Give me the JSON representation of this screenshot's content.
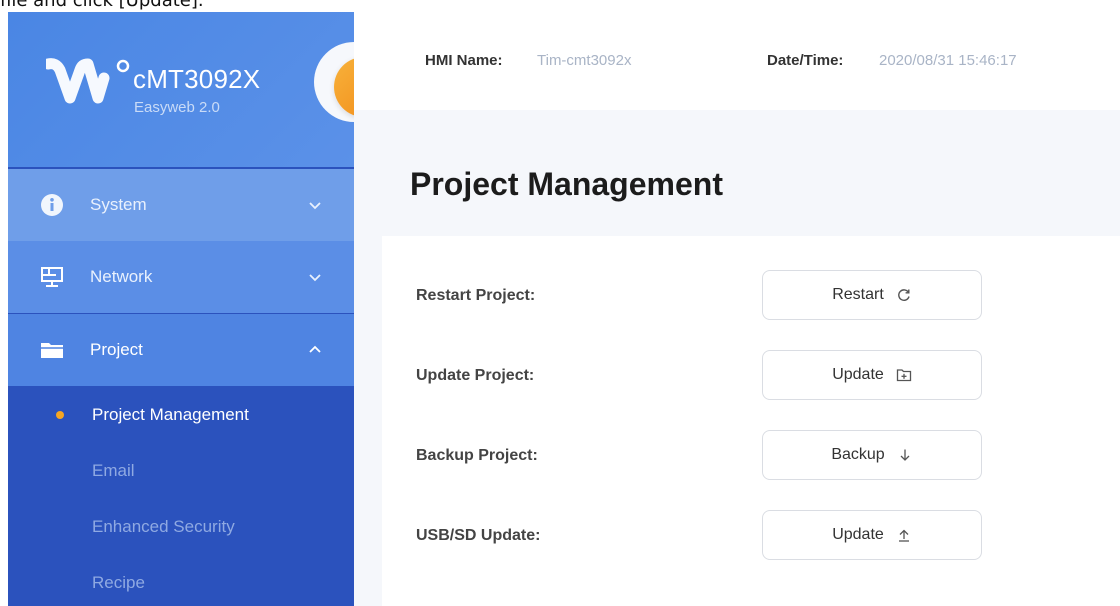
{
  "caption": "file and click [Update].",
  "brand": {
    "name": "cMT3092X",
    "subtitle": "Easyweb 2.0"
  },
  "sidebar": {
    "items": [
      {
        "label": "System",
        "icon": "info-icon",
        "expanded": false
      },
      {
        "label": "Network",
        "icon": "network-icon",
        "expanded": false
      },
      {
        "label": "Project",
        "icon": "folder-icon",
        "expanded": true
      }
    ],
    "sub_items": [
      {
        "label": "Project Management",
        "active": true
      },
      {
        "label": "Email",
        "active": false
      },
      {
        "label": "Enhanced Security",
        "active": false
      },
      {
        "label": "Recipe",
        "active": false
      }
    ]
  },
  "header": {
    "hmi_name_label": "HMI Name:",
    "hmi_name_value": "Tim-cmt3092x",
    "datetime_label": "Date/Time:",
    "datetime_value": "2020/08/31 15:46:17"
  },
  "main": {
    "title": "Project Management",
    "rows": [
      {
        "label": "Restart Project:",
        "button": "Restart",
        "icon": "refresh-icon"
      },
      {
        "label": "Update Project:",
        "button": "Update",
        "icon": "folder-plus-icon"
      },
      {
        "label": "Backup Project:",
        "button": "Backup",
        "icon": "download-arrow-icon"
      },
      {
        "label": "USB/SD Update:",
        "button": "Update",
        "icon": "upload-arrow-icon"
      }
    ]
  },
  "colors": {
    "sidebar_dark": "#2b52bd",
    "sidebar_light": "#4a86e4",
    "accent_orange": "#f5a623"
  }
}
